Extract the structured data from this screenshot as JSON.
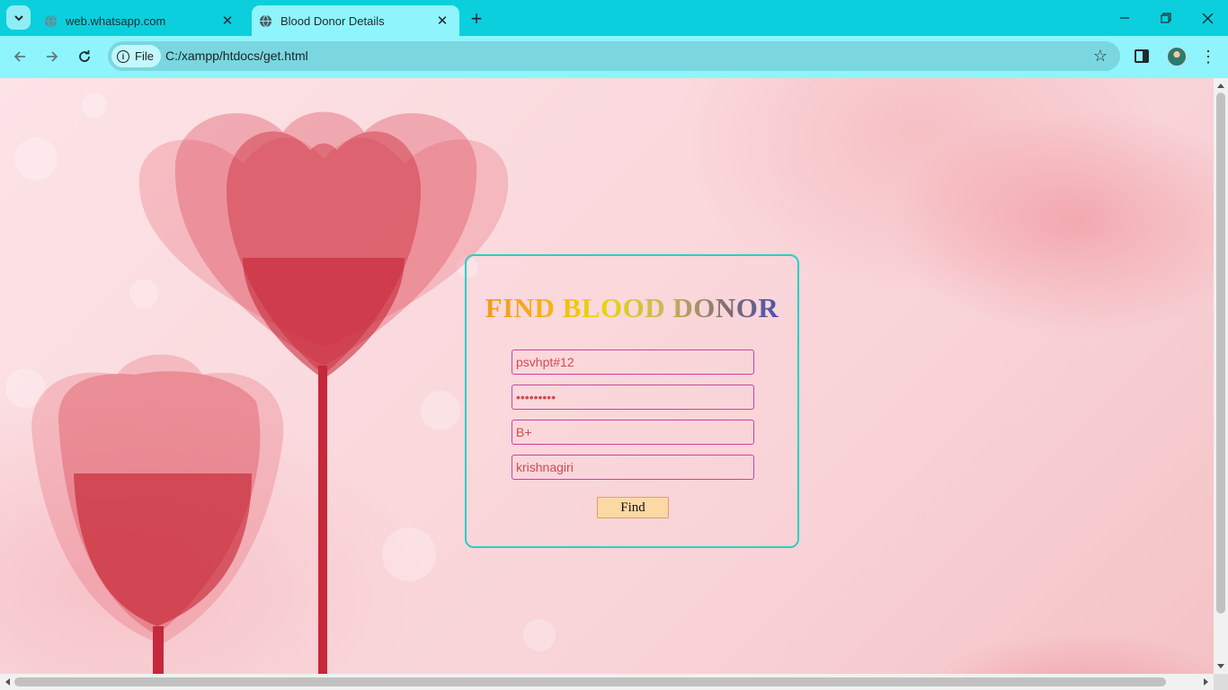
{
  "browser": {
    "tabs": [
      {
        "label": "web.whatsapp.com",
        "active": false
      },
      {
        "label": "Blood Donor Details",
        "active": true
      }
    ],
    "address_chip": "File",
    "url": "C:/xampp/htdocs/get.html"
  },
  "page": {
    "title": "FIND BLOOD DONOR",
    "fields": {
      "username": "psvhpt#12",
      "password": "•••••••••",
      "blood_group": "B+",
      "location": "krishnagiri"
    },
    "find_label": "Find"
  },
  "colors": {
    "chrome_bg": "#0bcfdd",
    "toolbar_bg": "#8ff4fb",
    "card_border": "#2ad0c7",
    "field_border": "#d13fa0",
    "field_text": "#d24a50",
    "button_bg": "#fcd9a3"
  },
  "icons": {
    "tab_search": "chevron-down-icon",
    "favicon": "globe-icon",
    "close": "close-icon",
    "new_tab": "plus-icon",
    "back": "arrow-left-icon",
    "forward": "arrow-right-icon",
    "reload": "reload-icon",
    "info": "info-icon",
    "bookmark": "star-icon",
    "side_panel": "side-panel-icon",
    "profile": "avatar",
    "menu": "kebab-menu-icon"
  }
}
